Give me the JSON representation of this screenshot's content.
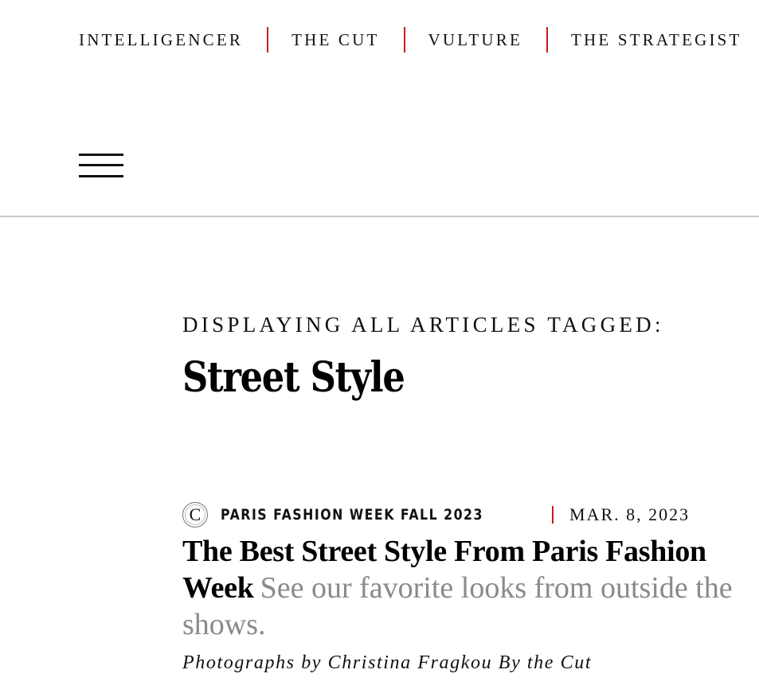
{
  "topnav": {
    "links": [
      "INTELLIGENCER",
      "THE CUT",
      "VULTURE",
      "THE STRATEGIST"
    ]
  },
  "header": {
    "menu_icon": "hamburger-menu-icon"
  },
  "tag_page": {
    "kicker": "DISPLAYING ALL ARTICLES TAGGED:",
    "title": "Street Style"
  },
  "articles": [
    {
      "publication_icon": "the-cut-logo-icon",
      "publication_letter": "C",
      "rubric": "PARIS FASHION WEEK FALL 2023",
      "date": "MAR. 8, 2023",
      "headline": "The Best Street Style From Paris Fashion Week",
      "dek": "See our favorite looks from outside the shows.",
      "byline": "Photographs by Christina Fragkou By the Cut"
    }
  ],
  "colors": {
    "accent_separator": "#c91b1b",
    "dek_gray": "#8a8a8a",
    "rule_gray": "#c9c9c9"
  }
}
